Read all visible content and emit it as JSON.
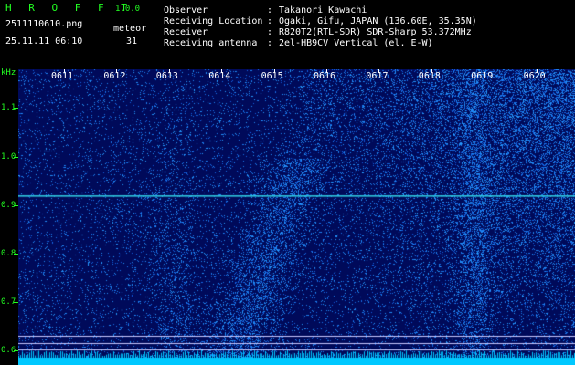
{
  "header": {
    "app_name": "H R O F F T",
    "version": "1.0.0",
    "filename": "2511110610.png",
    "mode_label": "meteor",
    "datetime": "25.11.11 06:10",
    "count": "31",
    "info_rows": [
      {
        "label": "Observer",
        "sep": ":",
        "value": "Takanori Kawachi"
      },
      {
        "label": "Receiving Location",
        "sep": ":",
        "value": "Ogaki, Gifu, JAPAN (136.60E, 35.35N)"
      },
      {
        "label": "Receiver",
        "sep": ":",
        "value": "R820T2(RTL-SDR) SDR-Sharp 53.372MHz"
      },
      {
        "label": "Receiving antenna",
        "sep": ":",
        "value": "2el-HB9CV Vertical (el. E-W)"
      }
    ]
  },
  "chart_data": {
    "type": "heatmap",
    "ylabel": "kHz",
    "y_ticks": [
      "1.1",
      "1.0",
      "0.9",
      "0.8",
      "0.7",
      "0.6"
    ],
    "x_ticks": [
      "0611",
      "0612",
      "0613",
      "0614",
      "0615",
      "0616",
      "0617",
      "0618",
      "0619",
      "0620"
    ],
    "ylim": [
      0.57,
      1.18
    ],
    "carrier_khz": 0.92,
    "colors": {
      "background": "#000a5a",
      "signal": "#3cc8ff",
      "axis": "#22ff22",
      "carrier": "#32d2e6",
      "baseline": "#00c8ff"
    }
  }
}
